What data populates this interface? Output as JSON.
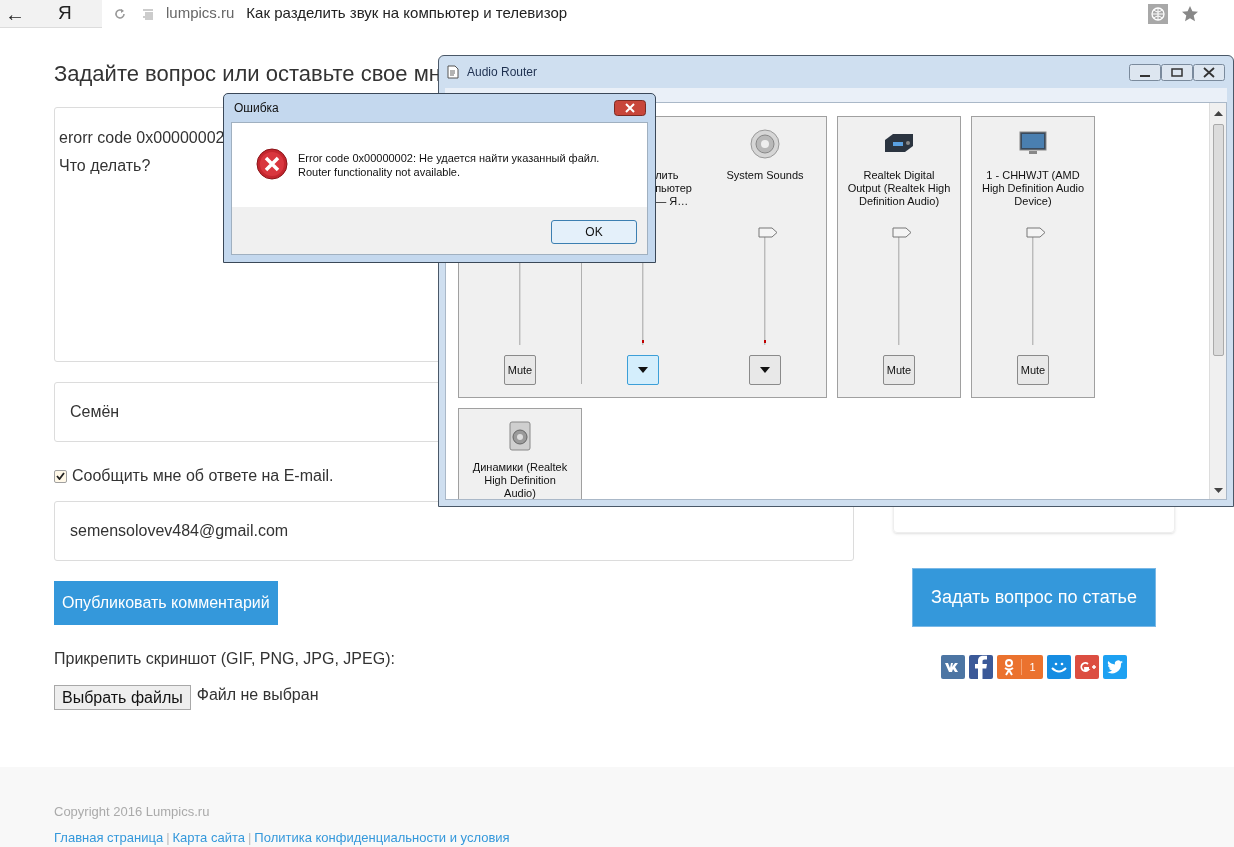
{
  "browser": {
    "back": "←",
    "logo": "Я",
    "domain": "lumpics.ru",
    "page_title": "Как разделить звук на компьютер и телевизор"
  },
  "form": {
    "heading": "Задайте вопрос или оставьте свое мн",
    "comment_lines": [
      "erorr code 0x00000002",
      "Что делать?"
    ],
    "name_value": "Семён",
    "notify": {
      "label": "Сообщить мне об ответе на E-mail.",
      "checked": true
    },
    "email_value": "semensolovev484@gmail.com",
    "submit": "Опубликовать комментарий",
    "attach_label": "Прикрепить скриншот (GIF, PNG, JPG, JPEG):",
    "file_button": "Выбрать файлы",
    "file_status": "Файл не выбран"
  },
  "sidebar": {
    "ask_button": "Задать вопрос по статье",
    "share": [
      {
        "kind": "vk"
      },
      {
        "kind": "facebook"
      },
      {
        "kind": "ok",
        "count": "1"
      },
      {
        "kind": "mail"
      },
      {
        "kind": "gplus"
      },
      {
        "kind": "twitter"
      }
    ]
  },
  "footer": {
    "copyright": "Copyright 2016 Lumpics.ru",
    "links": [
      "Главная страница",
      "Карта сайта",
      "Политика конфиденциальности и условия"
    ],
    "separator": "|"
  },
  "audio_router": {
    "title": "Audio Router",
    "panels": [
      {
        "columns": [
          {
            "kind": "device",
            "button": "Mute"
          },
          {
            "kind": "session",
            "label_lines": [
              "лить",
              "пьютер",
              "— Я…"
            ],
            "focused": true
          },
          {
            "kind": "session",
            "label_lines": [
              "System Sounds"
            ],
            "level": 1,
            "focused": false
          }
        ]
      },
      {
        "columns": [
          {
            "kind": "device",
            "label_lines": [
              "Realtek Digital",
              "Output (Realtek High",
              "Definition Audio)"
            ],
            "level": 1,
            "button": "Mute"
          }
        ]
      },
      {
        "columns": [
          {
            "kind": "device",
            "label_lines": [
              "1 - CHHWJT (AMD",
              "High Definition Audio",
              "Device)"
            ],
            "level": 1,
            "button": "Mute"
          }
        ]
      },
      {
        "columns": [
          {
            "kind": "device",
            "label_lines": [
              "Динамики (Realtek",
              "High Definition",
              "Audio)"
            ]
          }
        ]
      }
    ]
  },
  "error_dialog": {
    "title": "Ошибка",
    "message_lines": [
      "Error code 0x00000002: Не удается найти указанный файл.",
      "Router functionality not available."
    ],
    "ok": "OK"
  }
}
